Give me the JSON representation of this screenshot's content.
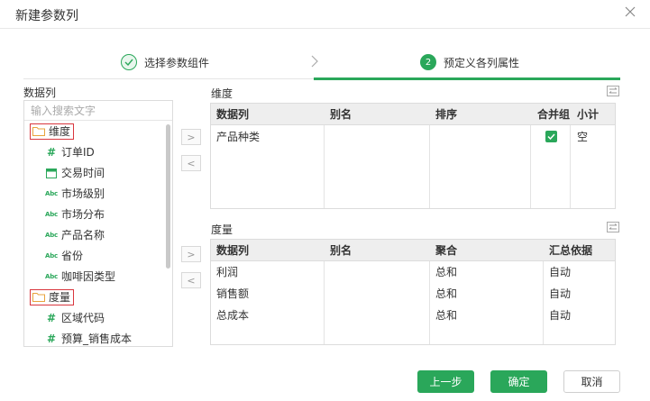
{
  "dialog": {
    "title": "新建参数列"
  },
  "steps": [
    {
      "label": "选择参数组件",
      "state": "done"
    },
    {
      "number": "2",
      "label": "预定义各列属性",
      "state": "active"
    }
  ],
  "data_columns": {
    "label": "数据列",
    "search_placeholder": "输入搜索文字",
    "groups": [
      {
        "label": "维度",
        "fields": [
          {
            "type": "number",
            "icon": "#",
            "label": "订单ID"
          },
          {
            "type": "date",
            "label": "交易时间"
          },
          {
            "type": "text",
            "icon": "Abc",
            "label": "市场级别"
          },
          {
            "type": "text",
            "icon": "Abc",
            "label": "市场分布"
          },
          {
            "type": "text",
            "icon": "Abc",
            "label": "产品名称"
          },
          {
            "type": "text",
            "icon": "Abc",
            "label": "省份"
          },
          {
            "type": "text",
            "icon": "Abc",
            "label": "咖啡因类型"
          }
        ]
      },
      {
        "label": "度量",
        "fields": [
          {
            "type": "number",
            "icon": "#",
            "label": "区域代码"
          },
          {
            "type": "number",
            "icon": "#",
            "label": "预算_销售成本"
          }
        ]
      }
    ]
  },
  "dimension_section": {
    "label": "维度",
    "columns": [
      "数据列",
      "别名",
      "排序",
      "合并组",
      "小计"
    ],
    "rows": [
      {
        "field": "产品种类",
        "alias": "",
        "sort": "",
        "merge_group": true,
        "subtotal": "空"
      }
    ]
  },
  "measure_section": {
    "label": "度量",
    "columns": [
      "数据列",
      "别名",
      "聚合",
      "汇总依据"
    ],
    "rows": [
      {
        "field": "利润",
        "alias": "",
        "aggregate": "总和",
        "summary_basis": "自动"
      },
      {
        "field": "销售额",
        "alias": "",
        "aggregate": "总和",
        "summary_basis": "自动"
      },
      {
        "field": "总成本",
        "alias": "",
        "aggregate": "总和",
        "summary_basis": "自动"
      }
    ]
  },
  "footer": {
    "prev_label": "上一步",
    "ok_label": "确定",
    "cancel_label": "取消"
  },
  "colors": {
    "accent": "#2aa75a",
    "highlight_border": "#d9363e"
  }
}
